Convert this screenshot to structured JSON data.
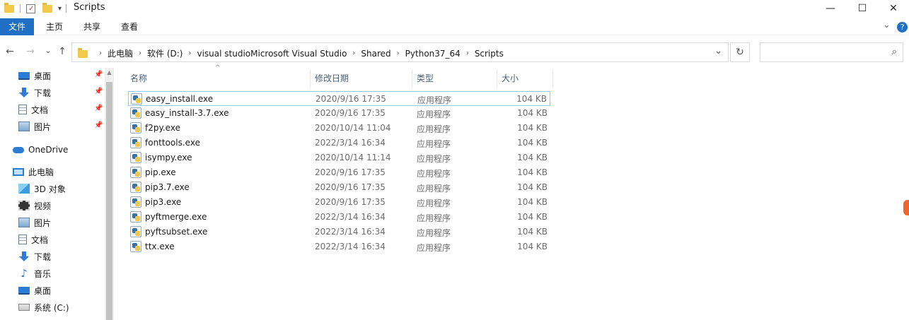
{
  "window": {
    "title": "Scripts",
    "minimize_glyph": "—",
    "maximize_glyph": "☐",
    "close_glyph": "✕",
    "dropdown_glyph": "▾"
  },
  "ribbon": {
    "tabs": [
      "文件",
      "主页",
      "共享",
      "查看"
    ],
    "expand_glyph": "⌄",
    "help_glyph": "?"
  },
  "nav": {
    "back_glyph": "←",
    "forward_glyph": "→",
    "recent_glyph": "⌄",
    "up_glyph": "↑"
  },
  "address": {
    "crumbs": [
      "此电脑",
      "软件 (D:)",
      "visual studioMicrosoft Visual Studio",
      "Shared",
      "Python37_64",
      "Scripts"
    ],
    "separator": "›",
    "dropdown_glyph": "⌄",
    "refresh_glyph": "↻"
  },
  "search": {
    "placeholder": "",
    "icon_glyph": "⌕"
  },
  "sidebar": {
    "pin_glyph": "📌",
    "quick_access": [
      {
        "label": "桌面",
        "icon": "desktop-icon"
      },
      {
        "label": "下载",
        "icon": "download-icon"
      },
      {
        "label": "文档",
        "icon": "documents-icon"
      },
      {
        "label": "图片",
        "icon": "pictures-icon"
      }
    ],
    "onedrive": {
      "label": "OneDrive",
      "icon": "onedrive-icon"
    },
    "this_pc": {
      "label": "此电脑",
      "icon": "this-pc-icon"
    },
    "pc_items": [
      {
        "label": "3D 对象",
        "icon": "3d-objects-icon"
      },
      {
        "label": "视频",
        "icon": "videos-icon"
      },
      {
        "label": "图片",
        "icon": "pictures-icon"
      },
      {
        "label": "文档",
        "icon": "documents-icon"
      },
      {
        "label": "下载",
        "icon": "download-icon"
      },
      {
        "label": "音乐",
        "icon": "music-icon"
      },
      {
        "label": "桌面",
        "icon": "desktop-icon"
      },
      {
        "label": "系统 (C:)",
        "icon": "drive-icon"
      }
    ]
  },
  "columns": {
    "name": "名称",
    "date": "修改日期",
    "type": "类型",
    "size": "大小",
    "sort_glyph": "^"
  },
  "files": [
    {
      "name": "easy_install.exe",
      "date": "2020/9/16 17:35",
      "type": "应用程序",
      "size": "104 KB",
      "selected": true
    },
    {
      "name": "easy_install-3.7.exe",
      "date": "2020/9/16 17:35",
      "type": "应用程序",
      "size": "104 KB"
    },
    {
      "name": "f2py.exe",
      "date": "2020/10/14 11:04",
      "type": "应用程序",
      "size": "104 KB"
    },
    {
      "name": "fonttools.exe",
      "date": "2022/3/14 16:34",
      "type": "应用程序",
      "size": "104 KB"
    },
    {
      "name": "isympy.exe",
      "date": "2020/10/14 11:14",
      "type": "应用程序",
      "size": "104 KB"
    },
    {
      "name": "pip.exe",
      "date": "2020/9/16 17:35",
      "type": "应用程序",
      "size": "104 KB"
    },
    {
      "name": "pip3.7.exe",
      "date": "2020/9/16 17:35",
      "type": "应用程序",
      "size": "104 KB"
    },
    {
      "name": "pip3.exe",
      "date": "2020/9/16 17:35",
      "type": "应用程序",
      "size": "104 KB"
    },
    {
      "name": "pyftmerge.exe",
      "date": "2022/3/14 16:34",
      "type": "应用程序",
      "size": "104 KB"
    },
    {
      "name": "pyftsubset.exe",
      "date": "2022/3/14 16:34",
      "type": "应用程序",
      "size": "104 KB"
    },
    {
      "name": "ttx.exe",
      "date": "2022/3/14 16:34",
      "type": "应用程序",
      "size": "104 KB"
    }
  ]
}
